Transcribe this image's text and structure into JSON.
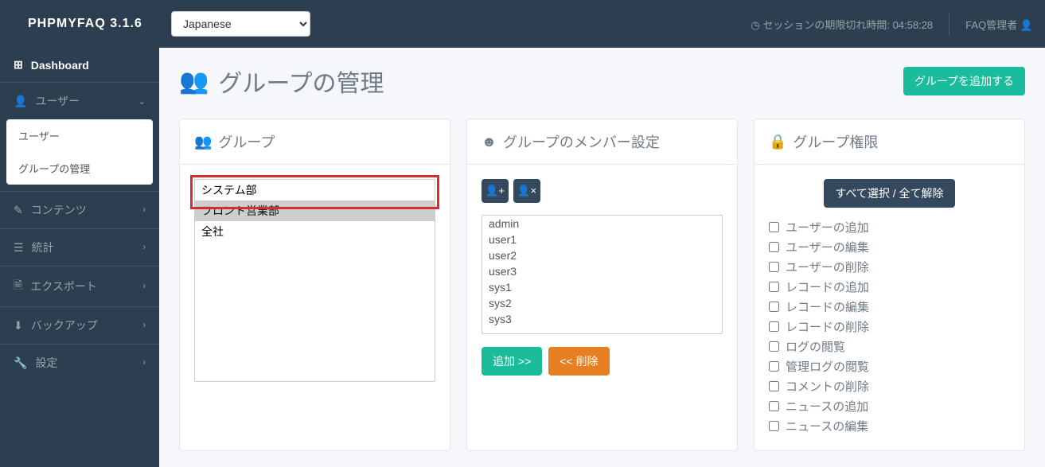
{
  "brand": "PHPMYFAQ 3.1.6",
  "language": "Japanese",
  "session": {
    "label": "セッションの期限切れ時間:",
    "time": "04:58:28"
  },
  "admin_user": "FAQ管理者",
  "sidebar": {
    "dashboard": "Dashboard",
    "user": "ユーザー",
    "submenu": {
      "users": "ユーザー",
      "groups": "グループの管理"
    },
    "contents": "コンテンツ",
    "stats": "統計",
    "export": "エクスポート",
    "backup": "バックアップ",
    "settings": "設定"
  },
  "page": {
    "title": "グループの管理",
    "add_btn": "グループを追加する"
  },
  "panel_groups": {
    "title": "グループ",
    "options": [
      "システム部",
      "フロント営業部",
      "全社"
    ],
    "selected": "フロント営業部"
  },
  "panel_members": {
    "title": "グループのメンバー設定",
    "users": [
      "admin",
      "user1",
      "user2",
      "user3",
      "sys1",
      "sys2",
      "sys3"
    ],
    "add_btn": "追加 >>",
    "remove_btn": "<< 削除"
  },
  "panel_perms": {
    "title": "グループ権限",
    "toggle_btn": "すべて選択 / 全て解除",
    "items": [
      "ユーザーの追加",
      "ユーザーの編集",
      "ユーザーの削除",
      "レコードの追加",
      "レコードの編集",
      "レコードの削除",
      "ログの閲覧",
      "管理ログの閲覧",
      "コメントの削除",
      "ニュースの追加",
      "ニュースの編集"
    ]
  }
}
